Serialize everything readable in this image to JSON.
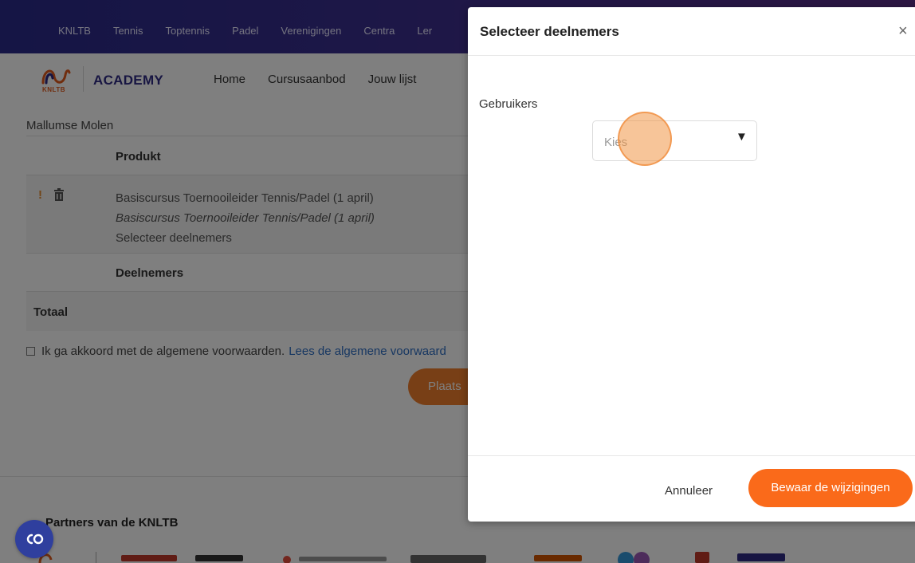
{
  "topnav": {
    "items": [
      "KNLTB",
      "Tennis",
      "Toptennis",
      "Padel",
      "Verenigingen",
      "Centra",
      "Ler"
    ]
  },
  "academy": {
    "logo_text": "KNLTB",
    "label": "ACADEMY",
    "nav": [
      "Home",
      "Cursusaanbod",
      "Jouw lijst"
    ]
  },
  "page": {
    "club_name": "Mallumse Molen",
    "product_header": "Produkt",
    "warning_mark": "!",
    "product_lines": [
      "Basiscursus Toernooileider Tennis/Padel (1 april)",
      "Basiscursus Toernooileider Tennis/Padel (1 april)",
      "Selecteer deelnemers"
    ],
    "participants_header": "Deelnemers",
    "total_label": "Totaal",
    "agree_text": "Ik ga akkoord met de algemene voorwaarden.",
    "agree_link": "Lees de algemene voorwaard",
    "place_button": "Plaats",
    "partners_title": "Partners van de KNLTB"
  },
  "modal": {
    "title": "Selecteer deelnemers",
    "close_glyph": "×",
    "field_label": "Gebruikers",
    "select_placeholder": "Kies",
    "select_arrow": "▼",
    "cancel_label": "Annuleer",
    "save_label": "Bewaar de wijzigingen"
  },
  "colors": {
    "accent": "#fa6a1a",
    "brand": "#2e2a85",
    "link": "#2f6fc4"
  }
}
